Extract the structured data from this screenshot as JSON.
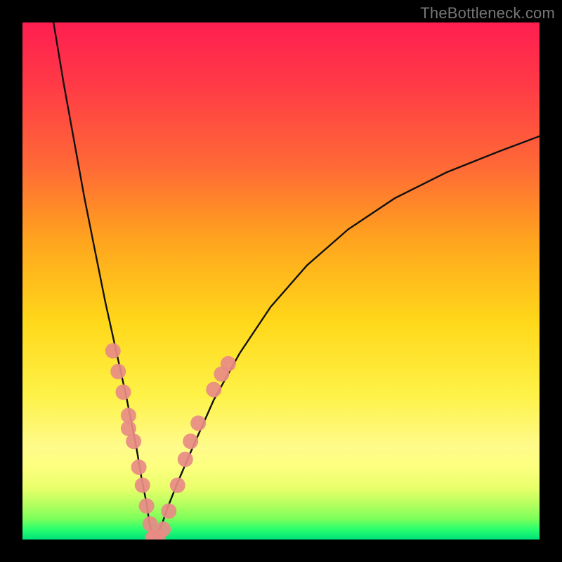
{
  "watermark": "TheBottleneck.com",
  "colors": {
    "frame": "#000000",
    "curve": "#111111",
    "dot": "#e88b85",
    "gradient": [
      "#ff1e50",
      "#ff3a46",
      "#ff6a36",
      "#ffa41e",
      "#ffd81a",
      "#fef247",
      "#fffb8a",
      "#fcff7e",
      "#e9ff6a",
      "#b8ff60",
      "#7cff5a",
      "#2aff6e",
      "#00e27a"
    ]
  },
  "chart_data": {
    "type": "line",
    "title": "",
    "xlabel": "",
    "ylabel": "",
    "x_is_normalized": true,
    "y_is_normalized": true,
    "xlim": [
      0,
      1
    ],
    "ylim": [
      0,
      1
    ],
    "series": [
      {
        "name": "bottleneck-curve",
        "x": [
          0.06,
          0.08,
          0.1,
          0.12,
          0.14,
          0.16,
          0.18,
          0.2,
          0.22,
          0.23,
          0.24,
          0.245,
          0.25,
          0.255,
          0.26,
          0.27,
          0.28,
          0.3,
          0.33,
          0.37,
          0.42,
          0.48,
          0.55,
          0.63,
          0.72,
          0.82,
          0.92,
          1.0
        ],
        "y": [
          1.0,
          0.88,
          0.77,
          0.66,
          0.56,
          0.46,
          0.37,
          0.28,
          0.18,
          0.12,
          0.07,
          0.035,
          0.01,
          0.0,
          0.01,
          0.03,
          0.06,
          0.11,
          0.18,
          0.27,
          0.36,
          0.45,
          0.53,
          0.6,
          0.66,
          0.71,
          0.75,
          0.78
        ]
      }
    ],
    "marker_clusters": [
      {
        "name": "left-cluster",
        "points": [
          {
            "x": 0.175,
            "y": 0.365
          },
          {
            "x": 0.185,
            "y": 0.325
          },
          {
            "x": 0.195,
            "y": 0.285
          },
          {
            "x": 0.205,
            "y": 0.24
          },
          {
            "x": 0.215,
            "y": 0.19
          },
          {
            "x": 0.205,
            "y": 0.215
          },
          {
            "x": 0.225,
            "y": 0.14
          },
          {
            "x": 0.232,
            "y": 0.105
          },
          {
            "x": 0.24,
            "y": 0.065
          },
          {
            "x": 0.247,
            "y": 0.03
          },
          {
            "x": 0.255,
            "y": 0.005
          }
        ]
      },
      {
        "name": "trough-cluster",
        "points": [
          {
            "x": 0.252,
            "y": 0.003
          },
          {
            "x": 0.262,
            "y": 0.005
          },
          {
            "x": 0.272,
            "y": 0.02
          },
          {
            "x": 0.283,
            "y": 0.055
          }
        ]
      },
      {
        "name": "right-cluster",
        "points": [
          {
            "x": 0.3,
            "y": 0.105
          },
          {
            "x": 0.315,
            "y": 0.155
          },
          {
            "x": 0.325,
            "y": 0.19
          },
          {
            "x": 0.34,
            "y": 0.225
          },
          {
            "x": 0.37,
            "y": 0.29
          },
          {
            "x": 0.385,
            "y": 0.32
          },
          {
            "x": 0.398,
            "y": 0.34
          }
        ]
      }
    ]
  }
}
